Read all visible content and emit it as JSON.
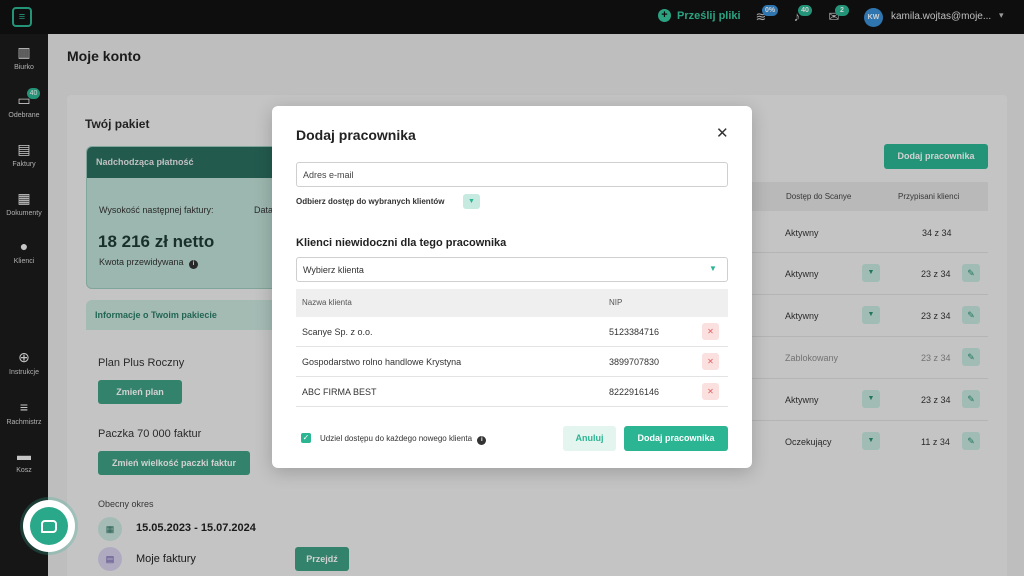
{
  "topbar": {
    "upload_label": "Prześlij pliki",
    "badges": {
      "storage": "0%",
      "notifications": "40",
      "messages": "2"
    },
    "avatar_initials": "KW",
    "user_email": "kamila.wojtas@moje...",
    "icons": [
      "logo-icon",
      "stack-icon",
      "bell-icon",
      "mail-icon",
      "chevron-down-icon"
    ]
  },
  "sidebar": {
    "items": [
      {
        "label": "Biurko",
        "icon": "desk-icon"
      },
      {
        "label": "Odebrane",
        "icon": "inbox-icon",
        "badge": "40"
      },
      {
        "label": "Faktury",
        "icon": "invoice-icon"
      },
      {
        "label": "Dokumenty",
        "icon": "document-icon"
      },
      {
        "label": "Klienci",
        "icon": "person-icon"
      },
      {
        "label": "Instrukcje",
        "icon": "lifebuoy-icon"
      },
      {
        "label": "Rachmistrz",
        "icon": "database-icon"
      },
      {
        "label": "Kosz",
        "icon": "trash-icon"
      }
    ]
  },
  "page": {
    "title": "Moje konto",
    "package": {
      "title": "Twój pakiet",
      "payment_header": "Nadchodząca płatność",
      "next_invoice_label": "Wysokość następnej faktury:",
      "date_label_partial": "Data",
      "amount": "18 216 zł netto",
      "amount_sub": "Kwota przewidywana",
      "info_header": "Informacje o Twoim pakiecie",
      "plan_name": "Plan Plus Roczny",
      "change_plan": "Zmień plan",
      "pack_size": "Paczka 70 000 faktur",
      "change_pack": "Zmień wielkość paczki faktur",
      "period_label": "Obecny okres",
      "period_value": "15.05.2023 - 15.07.2024",
      "my_invoices": "Moje faktury",
      "go_button": "Przejdź"
    },
    "employees": {
      "add_button": "Dodaj pracownika",
      "columns": [
        "Dostęp do Scanye",
        "Przypisani klienci"
      ],
      "rows": [
        {
          "status": "Aktywny",
          "count": "34 z 34"
        },
        {
          "status": "Aktywny",
          "count": "23 z 34"
        },
        {
          "status": "Aktywny",
          "count": "23 z 34"
        },
        {
          "status": "Zablokowany",
          "count": "23 z 34"
        },
        {
          "status": "Aktywny",
          "count": "23 z 34"
        },
        {
          "status": "Oczekujący",
          "count": "11 z 34"
        }
      ]
    }
  },
  "modal": {
    "title": "Dodaj pracownika",
    "email_placeholder": "Adres e-mail",
    "restrict_label": "Odbierz dostęp do wybranych klientów",
    "section_title": "Klienci niewidoczni dla tego pracownika",
    "select_placeholder": "Wybierz klienta",
    "columns": {
      "name": "Nazwa klienta",
      "nip": "NIP"
    },
    "rows": [
      {
        "name": "Scanye Sp. z o.o.",
        "nip": "5123384716"
      },
      {
        "name": "Gospodarstwo rolno handlowe Krystyna",
        "nip": "3899707830"
      },
      {
        "name": "ABC FIRMA BEST",
        "nip": "8222916146"
      }
    ],
    "checkbox_label": "Udziel dostępu do każdego nowego klienta",
    "cancel": "Anuluj",
    "submit": "Dodaj pracownika"
  },
  "colors": {
    "accent": "#2bb593",
    "dark": "#121212",
    "danger": "#e05c5c"
  }
}
